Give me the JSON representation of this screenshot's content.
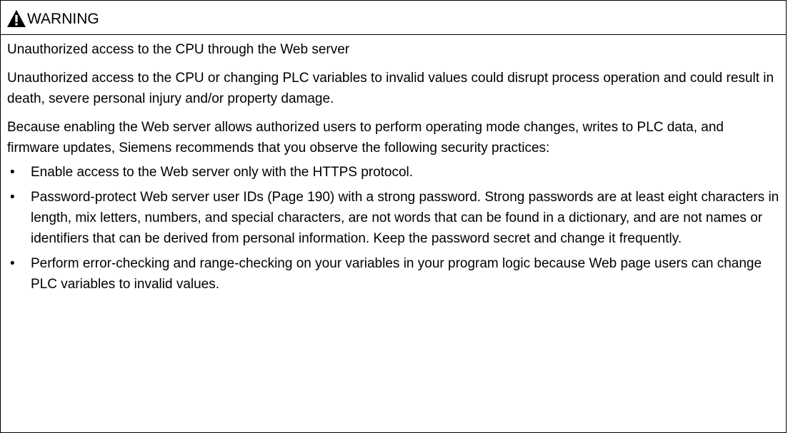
{
  "warning": {
    "icon": "warning-triangle-icon",
    "title": "WARNING",
    "subtitle": "Unauthorized access to the CPU through the Web server",
    "paragraphs": [
      "Unauthorized access to the CPU or changing PLC variables to invalid values could disrupt process operation and could result in death, severe personal injury and/or property damage.",
      "Because enabling the Web server allows authorized users to perform operating mode changes, writes to PLC data, and firmware updates, Siemens recommends that you observe the following security practices:"
    ],
    "bullets": [
      "Enable access to the Web server only with the HTTPS protocol.",
      "Password-protect Web server user IDs (Page 190) with a strong password. Strong passwords are at least eight characters in length, mix letters, numbers, and special characters, are not words that can be found in a dictionary, and are not names or identifiers that can be derived from personal information. Keep the password secret and change it frequently.",
      "Perform error-checking and range-checking on your variables in your program logic because Web page users can change PLC variables to invalid values."
    ],
    "bullet_glyph": "•",
    "colors": {
      "border": "#000000",
      "text": "#000000",
      "icon": "#000000",
      "background": "#ffffff"
    }
  }
}
